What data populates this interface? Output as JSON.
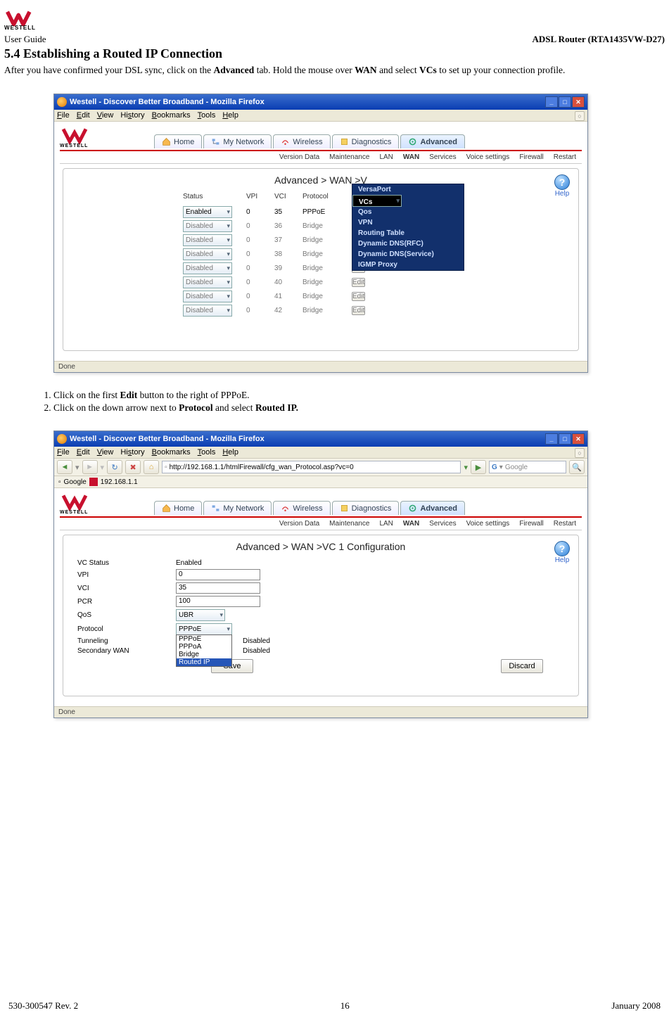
{
  "header": {
    "guide": "User Guide",
    "model": "ADSL Router (RTA1435VW-D27)",
    "section": "5.4 Establishing a Routed IP Connection",
    "intro_before_adv": "After you have confirmed your DSL sync, click on the ",
    "adv": "Advanced",
    "intro_mid": " tab. Hold the mouse over ",
    "wan": "WAN",
    "intro_mid2": " and select ",
    "vcs": "VCs",
    "intro_after": " to set up your connection profile."
  },
  "browser": {
    "title": "Westell - Discover Better Broadband - Mozilla Firefox",
    "menubar": [
      "File",
      "Edit",
      "View",
      "History",
      "Bookmarks",
      "Tools",
      "Help"
    ],
    "addr2": "http://192.168.1.1/htmlFirewall/cfg_wan_Protocol.asp?vc=0",
    "search_placeholder": "Google",
    "bookmark": "Google",
    "bookmark_ip": "192.168.1.1",
    "status": "Done"
  },
  "router": {
    "tabs": [
      "Home",
      "My Network",
      "Wireless",
      "Diagnostics",
      "Advanced"
    ],
    "subtabs": [
      "Version Data",
      "Maintenance",
      "LAN",
      "WAN",
      "Services",
      "Voice settings",
      "Firewall",
      "Restart"
    ],
    "help": "Help"
  },
  "screen1": {
    "title": "Advanced > WAN >V",
    "columns": [
      "Status",
      "VPI",
      "VCI",
      "Protocol"
    ],
    "rows": [
      {
        "status": "Enabled",
        "vpi": "0",
        "vci": "35",
        "proto": "PPPoE",
        "enabled": true
      },
      {
        "status": "Disabled",
        "vpi": "0",
        "vci": "36",
        "proto": "Bridge",
        "enabled": false
      },
      {
        "status": "Disabled",
        "vpi": "0",
        "vci": "37",
        "proto": "Bridge",
        "enabled": false
      },
      {
        "status": "Disabled",
        "vpi": "0",
        "vci": "38",
        "proto": "Bridge",
        "enabled": false
      },
      {
        "status": "Disabled",
        "vpi": "0",
        "vci": "39",
        "proto": "Bridge",
        "enabled": false
      },
      {
        "status": "Disabled",
        "vpi": "0",
        "vci": "40",
        "proto": "Bridge",
        "enabled": false
      },
      {
        "status": "Disabled",
        "vpi": "0",
        "vci": "41",
        "proto": "Bridge",
        "enabled": false
      },
      {
        "status": "Disabled",
        "vpi": "0",
        "vci": "42",
        "proto": "Bridge",
        "enabled": false
      }
    ],
    "edit": "Edit",
    "wan_menu": [
      "VersaPort",
      "VCs",
      "Qos",
      "VPN",
      "Routing Table",
      "Dynamic DNS(RFC)",
      "Dynamic DNS(Service)",
      "IGMP Proxy"
    ]
  },
  "steps": {
    "s1_a": "Click on the first ",
    "s1_b": "Edit",
    "s1_c": " button to the right of PPPoE.",
    "s2_a": "Click on the down arrow next to ",
    "s2_b": "Protocol",
    "s2_c": " and select ",
    "s2_d": "Routed IP."
  },
  "screen2": {
    "title": "Advanced > WAN >VC 1 Configuration",
    "labels": {
      "vcstatus": "VC Status",
      "vpi": "VPI",
      "vci": "VCI",
      "pcr": "PCR",
      "qos": "QoS",
      "protocol": "Protocol",
      "tunneling": "Tunneling",
      "secwan": "Secondary WAN"
    },
    "values": {
      "vcstatus": "Enabled",
      "vpi": "0",
      "vci": "35",
      "pcr": "100",
      "qos": "UBR",
      "protocol": "PPPoE",
      "tunneling": "Disabled",
      "secwan": "Disabled"
    },
    "options": [
      "PPPoE",
      "PPPoA",
      "Bridge",
      "Routed IP"
    ],
    "save": "Save",
    "discard": "Discard"
  },
  "footer": {
    "left": "530-300547 Rev. 2",
    "center": "16",
    "right": "January 2008"
  }
}
